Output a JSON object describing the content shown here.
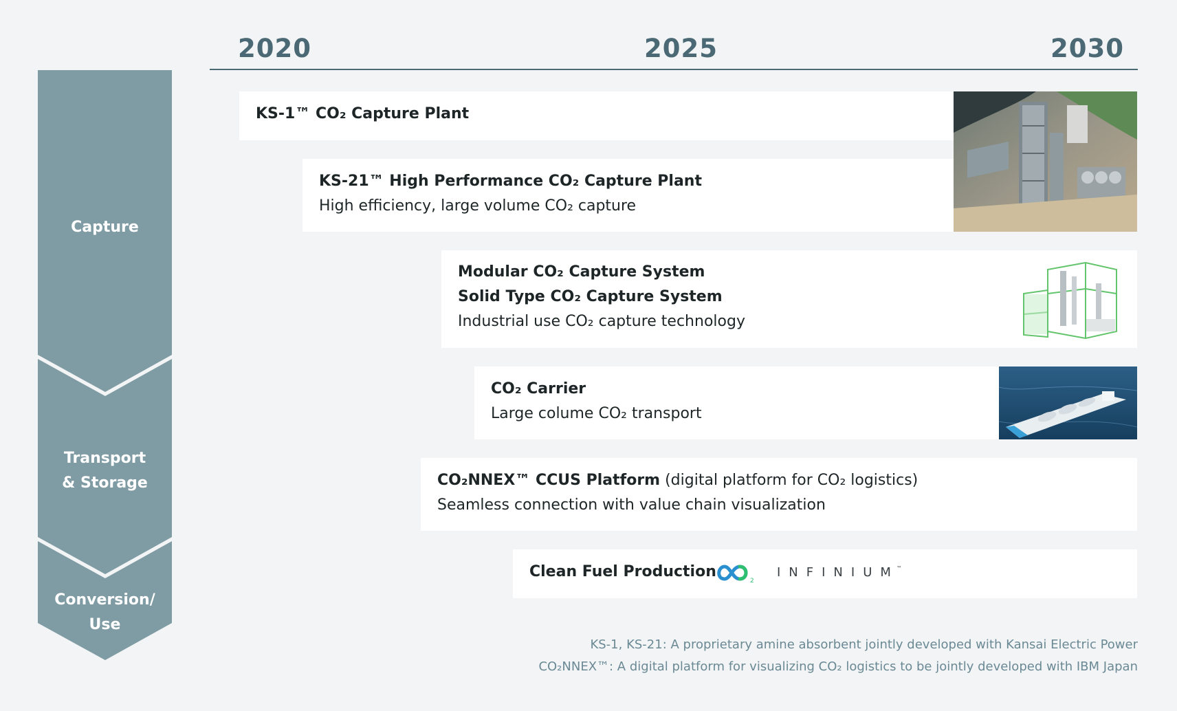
{
  "timeline": {
    "years": [
      "2020",
      "2025",
      "2030"
    ]
  },
  "stages": [
    {
      "label": "Capture"
    },
    {
      "label": "Transport\n& Storage"
    },
    {
      "label": "Conversion/\nUse"
    }
  ],
  "cards": {
    "ks1": {
      "title": "KS-1™ CO₂ Capture Plant"
    },
    "ks21": {
      "title": "KS-21™ High Performance CO₂ Capture Plant",
      "subtitle": "High efficiency, large volume CO₂ capture"
    },
    "modular": {
      "title1": "Modular CO₂ Capture System",
      "title2": "Solid Type CO₂ Capture System",
      "subtitle": "Industrial use CO₂ capture technology"
    },
    "carrier": {
      "title": "CO₂ Carrier",
      "subtitle": "Large colume CO₂ transport"
    },
    "connex": {
      "title_bold": "CO₂NNEX™ CCUS Platform",
      "title_rest": " (digital platform for CO₂ logistics)",
      "subtitle": "Seamless connection with value chain visualization"
    },
    "fuel": {
      "title": "Clean Fuel Production",
      "logo_sub": "2",
      "logo_word": "INFINIUM",
      "logo_tm": "™"
    }
  },
  "icons": {
    "ks_plant_photo": "capture-plant-photo",
    "modular_render": "modular-capture-unit-image",
    "ship_photo": "co2-carrier-ship-photo",
    "infinium_logo": "infinium-logo"
  },
  "colors": {
    "background": "#f2f4f5",
    "stage_fill": "#7f9ba3",
    "year_text": "#4b6875",
    "footnote_text": "#6a8995",
    "logo_green": "#2fbf71",
    "logo_blue": "#2a8fcf"
  },
  "footnotes": {
    "line1": "KS-1, KS-21: A proprietary amine absorbent jointly developed with Kansai Electric Power",
    "line2": "CO₂NNEX™: A digital platform for visualizing CO₂ logistics to be jointly developed with IBM Japan"
  }
}
